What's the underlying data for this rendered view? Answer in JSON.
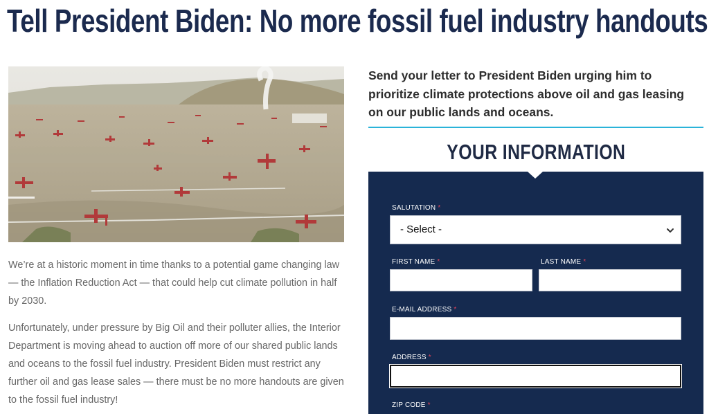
{
  "headline": "Tell President Biden: No more fossil fuel industry handouts!",
  "hero_image": {
    "alt": "Oil field with many pumpjacks"
  },
  "body": {
    "paragraphs": [
      "We’re at a historic moment in time thanks to a potential game changing law — the Inflation Reduction Act — that could help cut climate pollution in half by 2030.",
      "Unfortunately, under pressure by Big Oil and their polluter allies, the Interior Department is moving ahead to auction off more of our shared public lands and oceans to the fossil fuel industry. President Biden must restrict any further oil and gas lease sales — there must be no more handouts are given to the fossil fuel industry!"
    ]
  },
  "form": {
    "lede": "Send your letter to President Biden urging him to prioritize climate protections above oil and gas leasing on our public lands and oceans.",
    "section_title": "YOUR INFORMATION",
    "required_mark": "*",
    "salutation": {
      "label": "SALUTATION",
      "selected": "- Select -"
    },
    "first_name": {
      "label": "FIRST NAME",
      "value": ""
    },
    "last_name": {
      "label": "LAST NAME",
      "value": ""
    },
    "email": {
      "label": "E-MAIL ADDRESS",
      "value": ""
    },
    "address": {
      "label": "ADDRESS",
      "value": ""
    },
    "zip": {
      "label": "ZIP CODE"
    }
  },
  "colors": {
    "headline": "#1b2a4e",
    "panel": "#152a4f",
    "accent_rule": "#2ab3d9",
    "required": "#e0435a",
    "body_text": "#666666"
  },
  "icons": {
    "select_arrow": "chevron-down-icon"
  }
}
